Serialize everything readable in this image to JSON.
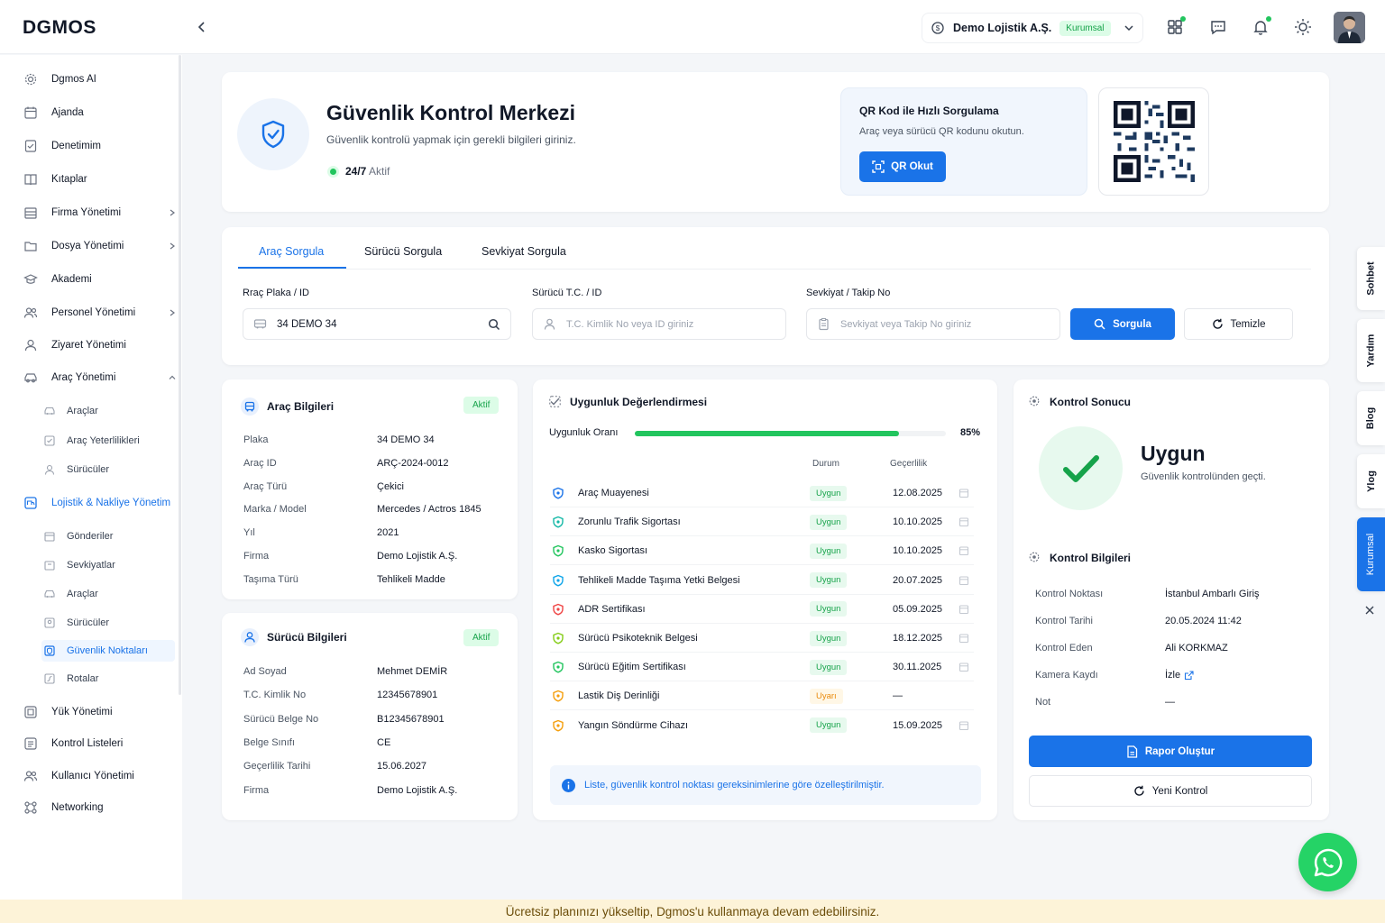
{
  "header": {
    "logo": "DGMOS",
    "company_name": "Demo Lojistik A.Ş.",
    "plan_badge": "Kurumsal"
  },
  "sidebar": {
    "items": [
      {
        "label": "Dgmos AI"
      },
      {
        "label": "Ajanda"
      },
      {
        "label": "Denetimim"
      },
      {
        "label": "Kıtaplar"
      },
      {
        "label": "Firma Yönetimi"
      },
      {
        "label": "Dosya Yönetimi"
      },
      {
        "label": "Akademi"
      },
      {
        "label": "Personel Yönetimi"
      },
      {
        "label": "Ziyaret Yönetimi"
      },
      {
        "label": "Araç Yönetimi"
      },
      {
        "label": "Lojistik & Nakliye Yönetim"
      },
      {
        "label": "Yük Yönetimi"
      },
      {
        "label": "Kontrol Listeleri"
      },
      {
        "label": "Kullanıcı Yönetimi"
      },
      {
        "label": "Networking"
      }
    ],
    "arac_sub": [
      "Araçlar",
      "Araç Yeterlilikleri",
      "Sürücüler"
    ],
    "lojistik_sub": [
      "Gönderiler",
      "Sevkiyatlar",
      "Araçlar",
      "Sürücüler",
      "Güvenlik Noktaları",
      "Rotalar"
    ]
  },
  "hero": {
    "title": "Güvenlik Kontrol Merkezi",
    "subtitle": "Güvenlik kontrolü yapmak için gerekli bilgileri giriniz.",
    "status_bold": "24/7",
    "status_text": "Aktif",
    "qr_title": "QR Kod ile Hızlı Sorgulama",
    "qr_desc": "Araç veya sürücü QR kodunu okutun.",
    "qr_button": "QR Okut"
  },
  "tabs": [
    "Araç Sorgula",
    "Sürücü Sorgula",
    "Sevkiyat Sorgula"
  ],
  "search": {
    "plate_label": "Rraç Plaka / ID",
    "plate_value": "34 DEMO 34",
    "driver_label": "Sürücü T.C. / ID",
    "driver_placeholder": "T.C. Kimlik No veya ID giriniz",
    "shipment_label": "Sevkiyat / Takip No",
    "shipment_placeholder": "Sevkiyat veya Takip No giriniz",
    "query_button": "Sorgula",
    "clear_button": "Temizle"
  },
  "vehicle": {
    "title": "Araç Bilgileri",
    "badge": "Aktif",
    "rows": [
      {
        "k": "Plaka",
        "v": "34 DEMO 34"
      },
      {
        "k": "Araç ID",
        "v": "ARÇ-2024-0012"
      },
      {
        "k": "Araç Türü",
        "v": "Çekici"
      },
      {
        "k": "Marka / Model",
        "v": "Mercedes / Actros 1845"
      },
      {
        "k": "Yıl",
        "v": "2021"
      },
      {
        "k": "Firma",
        "v": "Demo Lojistik A.Ş."
      },
      {
        "k": "Taşıma Türü",
        "v": "Tehlikeli Madde"
      }
    ]
  },
  "driver": {
    "title": "Sürücü Bilgileri",
    "badge": "Aktif",
    "rows": [
      {
        "k": "Ad Soyad",
        "v": "Mehmet DEMİR"
      },
      {
        "k": "T.C. Kimlik No",
        "v": "12345678901"
      },
      {
        "k": "Sürücü Belge No",
        "v": "B12345678901"
      },
      {
        "k": "Belge Sınıfı",
        "v": "CE"
      },
      {
        "k": "Geçerlilik Tarihi",
        "v": "15.06.2027"
      },
      {
        "k": "Firma",
        "v": "Demo Lojistik A.Ş."
      }
    ]
  },
  "compliance": {
    "title": "Uygunluk Değerlendirmesi",
    "rate_label": "Uygunluk Oranı",
    "rate_value": 85,
    "rate_text": "85%",
    "col_status": "Durum",
    "col_valid": "Geçerlilik",
    "rows": [
      {
        "label": "Araç Muayenesi",
        "status": "Uygun",
        "state": "ok",
        "date": "12.08.2025",
        "color": "#1a73e8"
      },
      {
        "label": "Zorunlu Trafik Sigortası",
        "status": "Uygun",
        "state": "ok",
        "date": "10.10.2025",
        "color": "#14b8a6"
      },
      {
        "label": "Kasko Sigortası",
        "status": "Uygun",
        "state": "ok",
        "date": "10.10.2025",
        "color": "#22c55e"
      },
      {
        "label": "Tehlikeli Madde Taşıma Yetki Belgesi",
        "status": "Uygun",
        "state": "ok",
        "date": "20.07.2025",
        "color": "#0ea5e9"
      },
      {
        "label": "ADR Sertifikası",
        "status": "Uygun",
        "state": "ok",
        "date": "05.09.2025",
        "color": "#ef4444"
      },
      {
        "label": "Sürücü Psikoteknik Belgesi",
        "status": "Uygun",
        "state": "ok",
        "date": "18.12.2025",
        "color": "#84cc16"
      },
      {
        "label": "Sürücü Eğitim Sertifikası",
        "status": "Uygun",
        "state": "ok",
        "date": "30.11.2025",
        "color": "#22c55e"
      },
      {
        "label": "Lastik Diş Derinliği",
        "status": "Uyarı",
        "state": "warn",
        "date": "—",
        "color": "#f59e0b"
      },
      {
        "label": "Yangın Söndürme Cihazı",
        "status": "Uygun",
        "state": "ok",
        "date": "15.09.2025",
        "color": "#f59e0b"
      }
    ],
    "info": "Liste, güvenlik kontrol noktası gereksinimlerine göre özelleştirilmiştir."
  },
  "result": {
    "title": "Kontrol Sonucu",
    "status": "Uygun",
    "status_sub": "Güvenlik kontrolünden geçti.",
    "info_title": "Kontrol Bilgileri",
    "rows": [
      {
        "k": "Kontrol Noktası",
        "v": "İstanbul Ambarlı Giriş"
      },
      {
        "k": "Kontrol Tarihi",
        "v": "20.05.2024 11:42"
      },
      {
        "k": "Kontrol Eden",
        "v": "Ali KORKMAZ"
      },
      {
        "k": "Kamera Kaydı",
        "v": "İzle"
      },
      {
        "k": "Not",
        "v": "—"
      }
    ],
    "report_button": "Rapor Oluştur",
    "new_button": "Yeni Kontrol"
  },
  "side_tabs": [
    "Sohbet",
    "Yardım",
    "Blog",
    "Ylog",
    "Kurumsal"
  ],
  "banner": "Ücretsiz planınızı yükseltip, Dgmos'u kullanmaya devam edebilirsiniz.",
  "colors": {
    "accent": "#1a73e8",
    "success": "#22c55e",
    "warning": "#f59e0b",
    "banner": "#fdf3d8"
  }
}
